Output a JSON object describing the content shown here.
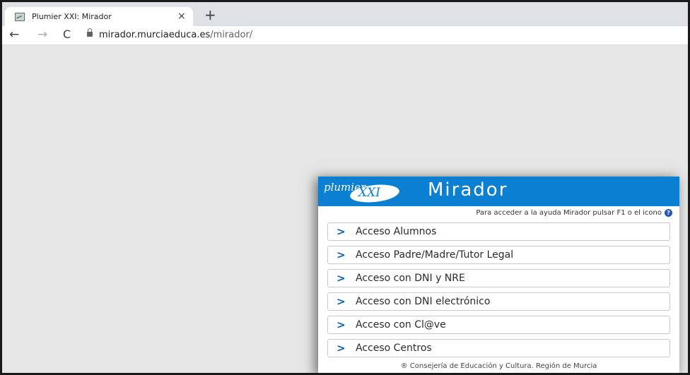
{
  "browser": {
    "tab_title": "Plumier XXI: Mirador",
    "tab_close": "×",
    "new_tab": "+",
    "back": "←",
    "forward": "→",
    "reload": "C",
    "url_host": "mirador.murciaeduca.es",
    "url_path": "/mirador/"
  },
  "panel": {
    "logo_script": "plumier",
    "logo_roman": "XXI",
    "title": "Mirador",
    "help_text": "Para acceder a la ayuda Mirador pulsar F1 o el icono",
    "help_icon_glyph": "?",
    "menu": [
      {
        "label": "Acceso Alumnos"
      },
      {
        "label": "Acceso Padre/Madre/Tutor Legal"
      },
      {
        "label": "Acceso con DNI y NRE"
      },
      {
        "label": "Acceso con DNI electrónico"
      },
      {
        "label": "Acceso con Cl@ve"
      },
      {
        "label": "Acceso Centros"
      }
    ],
    "chevron": ">",
    "footer": "® Consejería de Educación y Cultura. Región de Murcia"
  },
  "colors": {
    "header_blue": "#0b80d3",
    "page_bg": "#e6e6e6",
    "chevron_blue": "#0b5fb0"
  },
  "icons": [
    "favicon-icon",
    "close-icon",
    "plus-icon",
    "back-arrow-icon",
    "forward-arrow-icon",
    "reload-icon",
    "lock-icon",
    "help-icon",
    "chevron-right-icon"
  ]
}
